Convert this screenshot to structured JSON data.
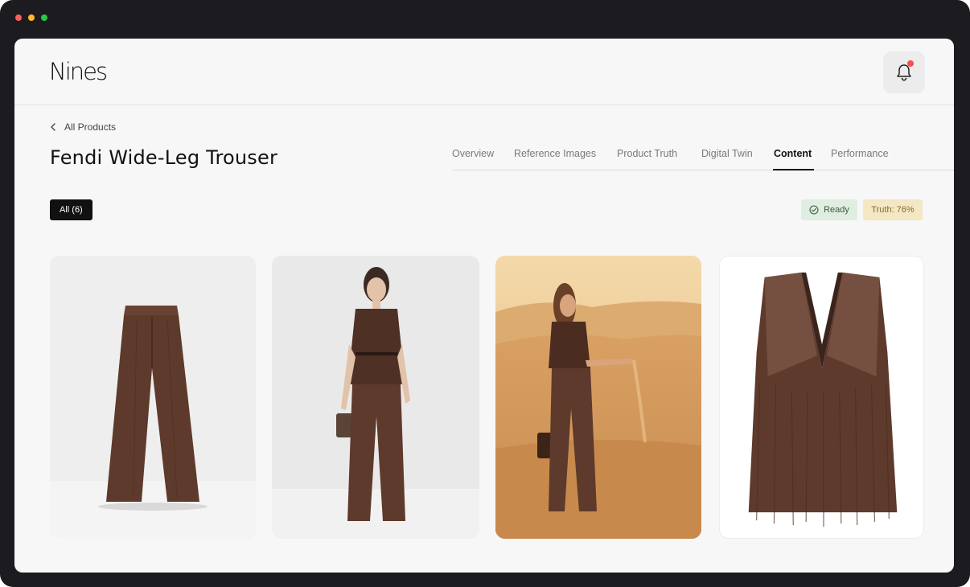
{
  "brand": {
    "logo_text": "Nines"
  },
  "header": {
    "notification_dot_color": "#ff4b4b"
  },
  "breadcrumb": {
    "back_label": "All Products"
  },
  "product": {
    "title": "Fendi Wide-Leg Trouser"
  },
  "tabs": [
    {
      "label": "Overview",
      "active": false
    },
    {
      "label": "Reference Images",
      "active": false
    },
    {
      "label": "Product Truth",
      "active": false
    },
    {
      "label": "Digital Twin",
      "active": false
    },
    {
      "label": "Content",
      "active": true
    },
    {
      "label": "Performance",
      "active": false
    }
  ],
  "filters": {
    "all_label": "All (6)"
  },
  "status": {
    "ready_label": "Ready",
    "truth_label": "Truth: 76%"
  },
  "gallery": [
    {
      "name": "trouser-product-shot"
    },
    {
      "name": "studio-model-shot"
    },
    {
      "name": "desert-model-shot"
    },
    {
      "name": "feather-vest-product-shot"
    }
  ],
  "colors": {
    "accent": "#111111",
    "ready_bg": "#dfeee1",
    "truth_bg": "#f3e7c4",
    "garment_brown": "#5e3a2c"
  }
}
